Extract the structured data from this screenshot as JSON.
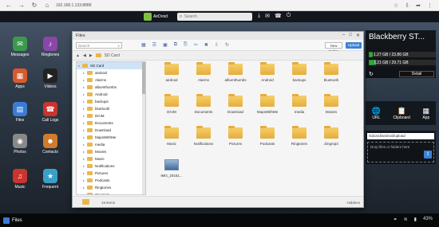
{
  "browser": {
    "url": "192.168.1.133:8888",
    "icons": [
      "back-icon",
      "forward-icon",
      "reload-icon",
      "home-icon"
    ]
  },
  "topbar": {
    "logo_text": "AirDroid",
    "search_placeholder": "Search"
  },
  "desktop": [
    {
      "label": "Messages",
      "color": "#3b9a4c",
      "glyph": "✉"
    },
    {
      "label": "Ringtones",
      "color": "#8a46a8",
      "glyph": "♪"
    },
    {
      "label": "Apps",
      "color": "#d85a2a",
      "glyph": "▦"
    },
    {
      "label": "Videos",
      "color": "#222222",
      "glyph": "▶"
    },
    {
      "label": "Files",
      "color": "#3a7bd5",
      "glyph": "▤"
    },
    {
      "label": "Call Logs",
      "color": "#c9342e",
      "glyph": "☎"
    },
    {
      "label": "Photos",
      "color": "#888888",
      "glyph": "◉"
    },
    {
      "label": "Contacts",
      "color": "#cf7a2e",
      "glyph": "☻"
    },
    {
      "label": "Music",
      "color": "#c9342e",
      "glyph": "♫"
    },
    {
      "label": "Frequent",
      "color": "#3aa0c8",
      "glyph": "★"
    }
  ],
  "window": {
    "title": "Files",
    "search_placeholder": "Search",
    "new_folder_label": "New Folder",
    "upload_label": "Upload",
    "path": "SD Card",
    "tree": [
      {
        "label": "SD Card",
        "selected": true,
        "expanded": true
      },
      {
        "label": "airdroid"
      },
      {
        "label": "Alarms"
      },
      {
        "label": "albumthumbs"
      },
      {
        "label": "Android"
      },
      {
        "label": "backups"
      },
      {
        "label": "bluetooth"
      },
      {
        "label": "DCIM"
      },
      {
        "label": "Documents"
      },
      {
        "label": "Download"
      },
      {
        "label": "MapsWithMe"
      },
      {
        "label": "media"
      },
      {
        "label": "Movies"
      },
      {
        "label": "Music"
      },
      {
        "label": "Notifications"
      },
      {
        "label": "Pictures"
      },
      {
        "label": "Podcasts"
      },
      {
        "label": "Ringtones"
      },
      {
        "label": "Zingmp3"
      }
    ],
    "grid": [
      {
        "label": "airdroid"
      },
      {
        "label": "Alarms"
      },
      {
        "label": "albumthumbs"
      },
      {
        "label": "Android"
      },
      {
        "label": "backups"
      },
      {
        "label": "bluetooth"
      },
      {
        "label": "DCIM"
      },
      {
        "label": "Documents"
      },
      {
        "label": "Download"
      },
      {
        "label": "MapsWithMe"
      },
      {
        "label": "media"
      },
      {
        "label": "Movies"
      },
      {
        "label": "Music"
      },
      {
        "label": "Notifications"
      },
      {
        "label": "Pictures"
      },
      {
        "label": "Podcasts"
      },
      {
        "label": "Ringtones"
      },
      {
        "label": "Zingmp3"
      },
      {
        "label": "IMG_20151...",
        "image": true
      }
    ],
    "status_count": "19 items",
    "status_hidden": "Hiddens"
  },
  "device": {
    "name": "Blackberry ST...",
    "storage": [
      {
        "text": "1.27 GB / 23.86 GB",
        "fraction": 0.05
      },
      {
        "text": "3.21 GB / 29.71 GB",
        "fraction": 0.11
      }
    ],
    "detail_label": "Detail"
  },
  "tools": [
    {
      "label": "URL",
      "glyph": "🌐"
    },
    {
      "label": "Clipboard",
      "glyph": "📋"
    },
    {
      "label": "App",
      "glyph": "▦"
    }
  ],
  "upload": {
    "path": "/sdcard/airdroid/upload",
    "drop_text": "Drop files or folders here"
  },
  "taskbar": {
    "app_label": "Files",
    "battery": "43%"
  }
}
